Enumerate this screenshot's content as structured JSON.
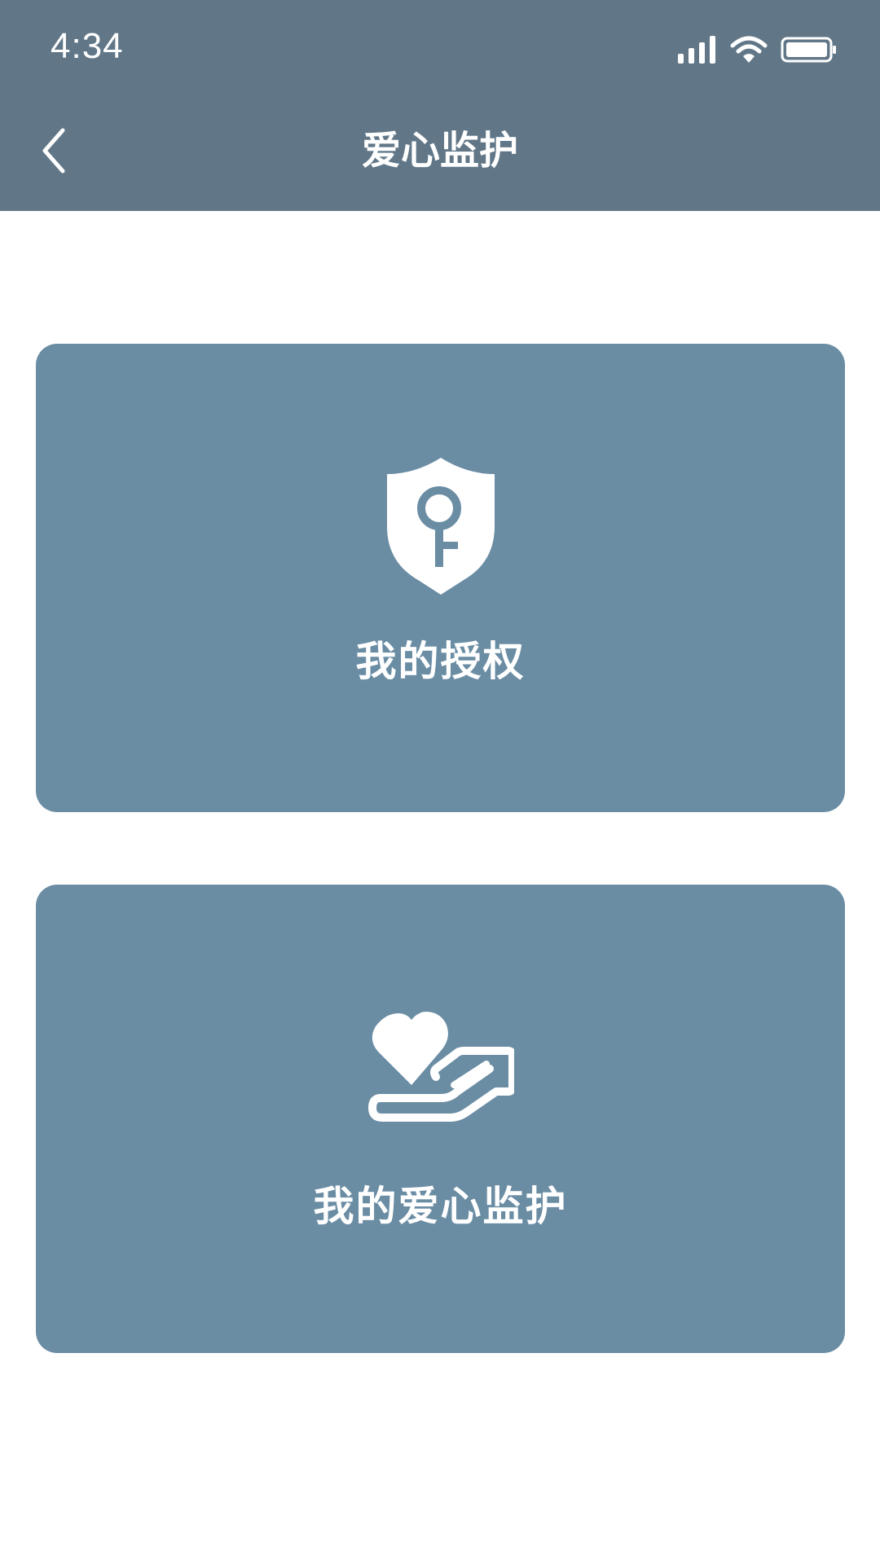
{
  "status_bar": {
    "time": "4:34",
    "icons": [
      "signal-icon",
      "wifi-icon",
      "battery-icon"
    ]
  },
  "nav": {
    "title": "爱心监护",
    "back_icon": "chevron-left-icon"
  },
  "cards": [
    {
      "label": "我的授权",
      "icon": "shield-key-icon"
    },
    {
      "label": "我的爱心监护",
      "icon": "heart-hand-icon"
    }
  ],
  "colors": {
    "header_bg": "#617788",
    "card_bg": "#6b8da4",
    "text": "#ffffff",
    "page_bg": "#ffffff"
  }
}
